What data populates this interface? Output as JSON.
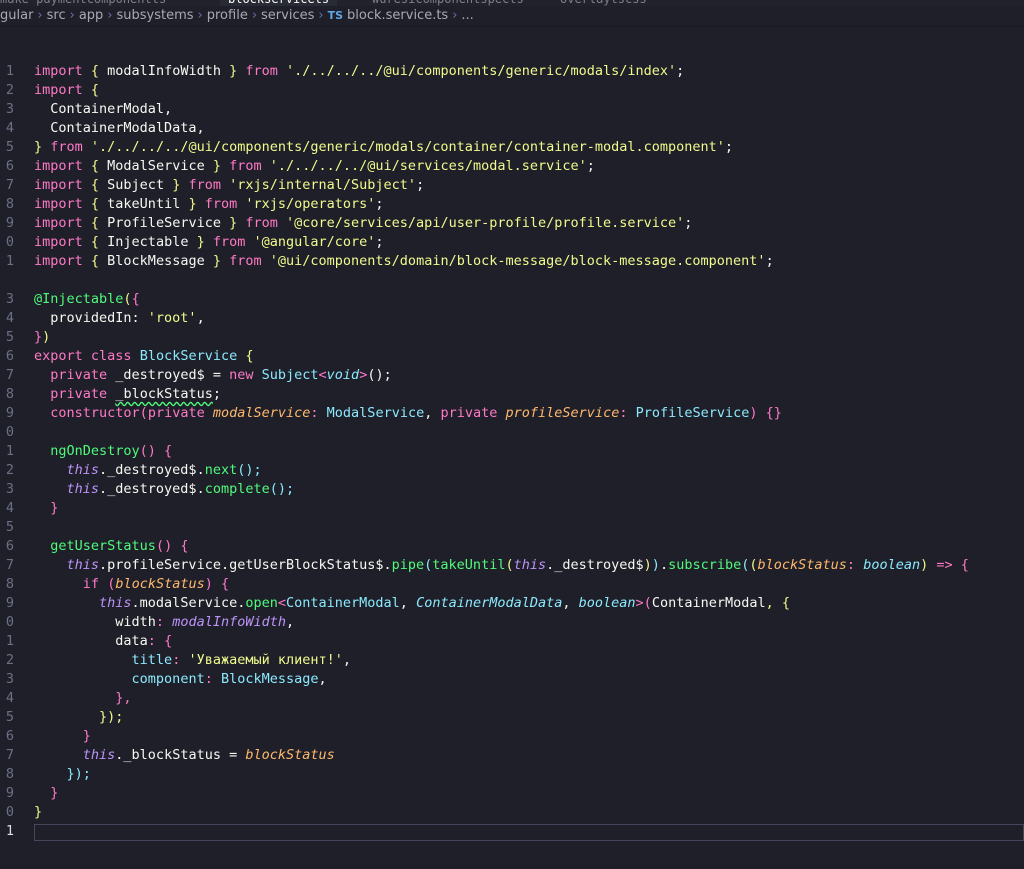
{
  "tabs": [
    {
      "label": "make-paymentcomponentts",
      "active": false
    },
    {
      "label": "blockservicets",
      "active": true
    },
    {
      "label": "wuresicomponentspects",
      "active": false
    },
    {
      "label": "overlaytscss",
      "active": false
    }
  ],
  "breadcrumb": {
    "items": [
      "gular",
      "src",
      "app",
      "subsystems",
      "profile",
      "services"
    ],
    "file_badge": "TS",
    "file_name": "block.service.ts",
    "ellipsis": "..."
  },
  "line_numbers": [
    "1",
    "2",
    "3",
    "4",
    "5",
    "6",
    "7",
    "8",
    "9",
    "0",
    "1",
    "",
    "3",
    "4",
    "5",
    "6",
    "7",
    "8",
    "9",
    "0",
    "1",
    "2",
    "3",
    "4",
    "5",
    "6",
    "7",
    "8",
    "9",
    "0",
    "1",
    "2",
    "3",
    "4",
    "5",
    "6",
    "7",
    "8",
    "9",
    "0",
    "1"
  ],
  "code": {
    "l1": {
      "kw": "import",
      "open": " { ",
      "name": "modalInfoWidth",
      "close": " } ",
      "from": "from",
      "str": "'./../../../@ui/components/generic/modals/index'",
      "end": ";"
    },
    "l2": {
      "kw": "import",
      "rest": " {"
    },
    "l3": {
      "text": "  ContainerModal,"
    },
    "l4": {
      "text": "  ContainerModalData,"
    },
    "l5": {
      "close": "} ",
      "from": "from",
      "str": "'./../../../@ui/components/generic/modals/container/container-modal.component'",
      "end": ";"
    },
    "l6": {
      "kw": "import",
      "open": " { ",
      "name": "ModalService",
      "close": " } ",
      "from": "from",
      "str": "'./../../../@ui/services/modal.service'",
      "end": ";"
    },
    "l7": {
      "kw": "import",
      "open": " { ",
      "name": "Subject",
      "close": " } ",
      "from": "from",
      "str": "'rxjs/internal/Subject'",
      "end": ";"
    },
    "l8": {
      "kw": "import",
      "open": " { ",
      "name": "takeUntil",
      "close": " } ",
      "from": "from",
      "str": "'rxjs/operators'",
      "end": ";"
    },
    "l9": {
      "kw": "import",
      "open": " { ",
      "name": "ProfileService",
      "close": " } ",
      "from": "from",
      "str": "'@core/services/api/user-profile/profile.service'",
      "end": ";"
    },
    "l10": {
      "kw": "import",
      "open": " { ",
      "name": "Injectable",
      "close": " } ",
      "from": "from",
      "str": "'@angular/core'",
      "end": ";"
    },
    "l11": {
      "kw": "import",
      "open": " { ",
      "name": "BlockMessage",
      "close": " } ",
      "from": "from",
      "str": "'@ui/components/domain/block-message/block-message.component'",
      "end": ";"
    },
    "l13": {
      "at": "@",
      "dec": "Injectable",
      "paren": "(",
      "brace": "{"
    },
    "l14": {
      "prop": "  providedIn: ",
      "str": "'root'",
      "end": ","
    },
    "l15": {
      "brace": "}",
      "paren": ")"
    },
    "l16": {
      "kw": "export",
      "kw2": "class",
      "name": "BlockService",
      "brace": "{"
    },
    "l17": {
      "kw": "private",
      "var": " _destroyed$ = ",
      "new": "new",
      "cls": "Subject",
      "lt": "<",
      "type": "void",
      "gt": ">",
      "call": "();"
    },
    "l18": {
      "kw": "private",
      "var": "_blockStatus",
      "end": ";"
    },
    "l19": {
      "ctor": "constructor",
      "p1kw": "private",
      "p1": "modalService",
      "c1": ": ",
      "t1": "ModalService",
      "sep": ", ",
      "p2kw": "private",
      "p2": "profileService",
      "c2": ": ",
      "t2": "ProfileService",
      "end": ") {}"
    },
    "l21": {
      "fn": "ngOnDestroy",
      "rest": "() {"
    },
    "l22": {
      "this": "this",
      "obj": "._destroyed$.",
      "fn": "next",
      "end": "();"
    },
    "l23": {
      "this": "this",
      "obj": "._destroyed$.",
      "fn": "complete",
      "end": "();"
    },
    "l24": {
      "close": "}"
    },
    "l26": {
      "fn": "getUserStatus",
      "rest": "() {"
    },
    "l27": {
      "this": "this",
      "a": ".profileService.getUserBlockStatus$.",
      "pipe": "pipe",
      "tu": "takeUntil",
      "this2": "this",
      "b": "._destroyed$",
      "sub": "subscribe",
      "param": "blockStatus",
      "colon": ": ",
      "type": "boolean",
      "arrow": " => {"
    },
    "l28": {
      "kw": "if",
      "param": "blockStatus",
      "end": ") {"
    },
    "l29": {
      "this": "this",
      "a": ".modalService.",
      "fn": "open",
      "lt": "<",
      "t1": "ContainerModal",
      "sep1": ", ",
      "t2": "ContainerModalData",
      "sep2": ", ",
      "t3": "boolean",
      "gt": ">(",
      "arg": "ContainerModal",
      "end": ", {"
    },
    "l30": {
      "prop": "width",
      "colon": ": ",
      "val": "modalInfoWidth",
      "end": ","
    },
    "l31": {
      "prop": "data",
      "colon": ": ",
      "brace": "{"
    },
    "l32": {
      "prop": "title",
      "colon": ": ",
      "str": "'Уважаемый клиент!'",
      "end": ","
    },
    "l33": {
      "prop": "component",
      "colon": ": ",
      "val": "BlockMessage",
      "end": ","
    },
    "l34": {
      "text": "},"
    },
    "l35": {
      "text": "});"
    },
    "l36": {
      "text": "}"
    },
    "l37": {
      "this": "this",
      "a": "._blockStatus = ",
      "val": "blockStatus"
    },
    "l38": {
      "text": "});"
    },
    "l39": {
      "text": "}"
    },
    "l40": {
      "text": "}"
    }
  },
  "colors": {
    "background": "#1e1f29",
    "keyword": "#ff79c6",
    "string": "#f1fa8c",
    "function": "#50fa7b",
    "class": "#8be9fd",
    "parameter": "#ffb86c"
  }
}
